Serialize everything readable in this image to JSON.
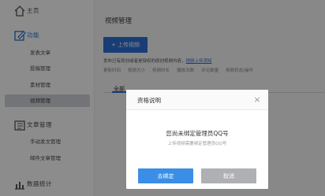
{
  "sidebar": {
    "home_label": "主页",
    "function_label": "功能",
    "function_items": [
      "发表文章",
      "投稿管理",
      "素材管理",
      "视频管理"
    ],
    "article_label": "文章管理",
    "article_items": [
      "手动发文管理",
      "邮件文章管理"
    ],
    "stats_label": "数据统计"
  },
  "main": {
    "title": "视频管理",
    "upload_button": "+ 上传视频",
    "notice_text": "发布已有原创或者是授权的原创视频内容，",
    "notice_link": "视频上传须知",
    "filters": [
      "更新时间",
      "视频大小",
      "视频时长",
      "播放次数",
      "评论数量",
      "视频状态/操作"
    ],
    "tab_all": "全部"
  },
  "dialog": {
    "title": "资格说明",
    "message": "您尚未绑定管理员QQ号",
    "sub_message": "上传视频需要绑定管理员QQ号",
    "bind_button": "去绑定",
    "cancel_button": "取消"
  }
}
